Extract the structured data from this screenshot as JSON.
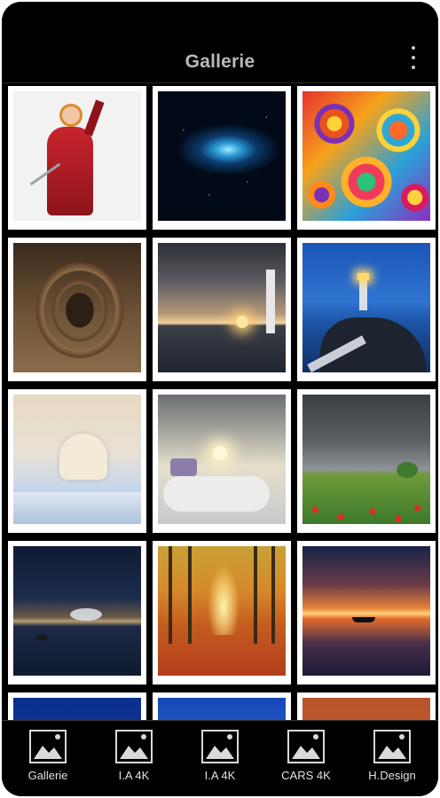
{
  "header": {
    "title": "Gallerie",
    "menu_icon": "more-vert-icon"
  },
  "gallery": {
    "rows": [
      [
        "clown",
        "nebula",
        "mandala"
      ],
      [
        "tunnel",
        "lighthouse-sunset",
        "lighthouse-blue"
      ],
      [
        "white-horse",
        "fantasy-clouds",
        "flower-field"
      ],
      [
        "night-lake",
        "autumn-forest",
        "sunset-boat"
      ],
      [
        "blue-partial",
        "sky-partial",
        "orange-partial"
      ]
    ]
  },
  "tabbar": {
    "tabs": [
      {
        "label": "Gallerie",
        "icon": "image-icon"
      },
      {
        "label": "I.A 4K",
        "icon": "image-icon"
      },
      {
        "label": "I.A 4K",
        "icon": "image-icon"
      },
      {
        "label": "CARS 4K",
        "icon": "image-icon"
      },
      {
        "label": "H.Design",
        "icon": "image-icon"
      }
    ]
  },
  "colors": {
    "background": "#000000",
    "title": "#b9b9b9",
    "tile_border": "#ffffff",
    "tab_text": "#e2e2e2"
  }
}
